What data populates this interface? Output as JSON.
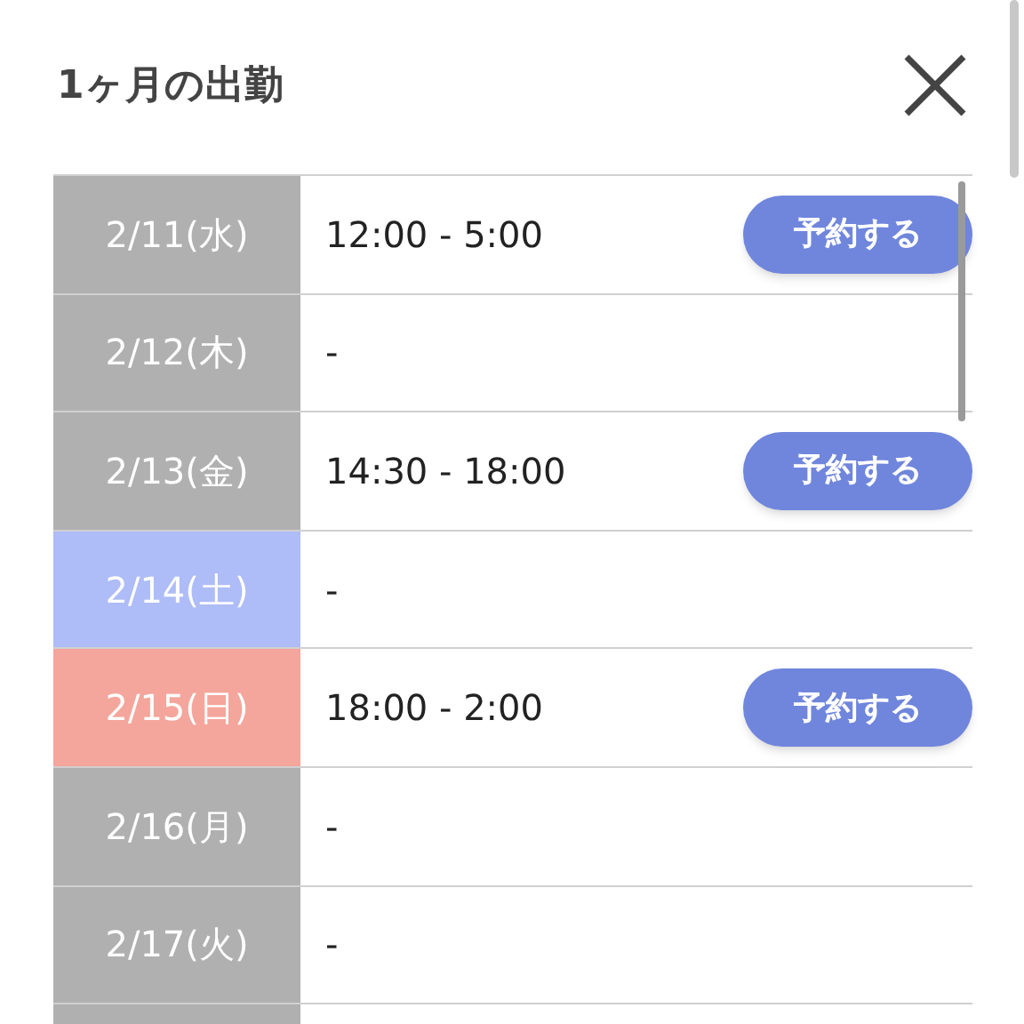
{
  "title": "1ヶ月の出勤",
  "schedule": [
    {
      "date": "2/11(水)",
      "kind": "weekday",
      "hours": "12:00 - 5:00",
      "reserve_button": "予約する"
    },
    {
      "date": "2/12(木)",
      "kind": "weekday",
      "hours": "-"
    },
    {
      "date": "2/13(金)",
      "kind": "weekday",
      "hours": "14:30 - 18:00",
      "reserve_button": "予約する"
    },
    {
      "date": "2/14(土)",
      "kind": "saturday",
      "hours": "-"
    },
    {
      "date": "2/15(日)",
      "kind": "sunday",
      "hours": "18:00 - 2:00",
      "reserve_button": "予約する"
    },
    {
      "date": "2/16(月)",
      "kind": "weekday",
      "hours": "-"
    },
    {
      "date": "2/17(火)",
      "kind": "weekday",
      "hours": "-"
    }
  ]
}
